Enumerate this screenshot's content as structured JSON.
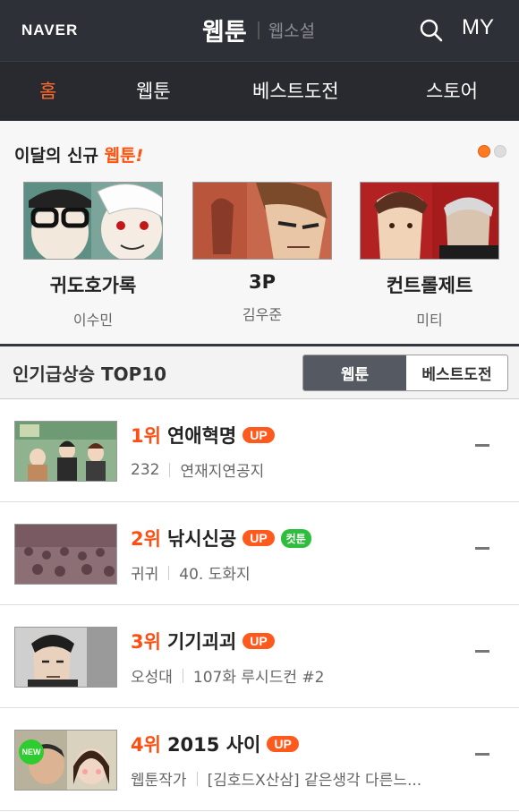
{
  "header": {
    "logo": "NAVER",
    "title": "웹툰",
    "subtitle": "웹소설",
    "search_icon": "search-icon",
    "my_label": "MY"
  },
  "nav": {
    "items": [
      {
        "label": "홈",
        "active": true
      },
      {
        "label": "웹툰",
        "active": false
      },
      {
        "label": "베스트도전",
        "active": false
      },
      {
        "label": "스토어",
        "active": false
      }
    ]
  },
  "new_section": {
    "title_prefix": "이달의 신규 ",
    "title_accent": "웹툰",
    "title_suffix": "!",
    "page_indicator": {
      "total": 2,
      "current": 1
    },
    "cards": [
      {
        "title": "귀도호가록",
        "author": "이수민"
      },
      {
        "title": "3P",
        "author": "김우준"
      },
      {
        "title": "컨트롤제트",
        "author": "미티"
      }
    ]
  },
  "top10": {
    "title": "인기급상승 TOP10",
    "toggle": {
      "active": "웹툰",
      "inactive": "베스트도전"
    },
    "items": [
      {
        "rank": "1위",
        "title": "연애혁명",
        "badge": "UP",
        "extra_badge": "",
        "new": false,
        "meta1": "232",
        "meta2": "연재지연공지"
      },
      {
        "rank": "2위",
        "title": "낚시신공",
        "badge": "UP",
        "extra_badge": "컷툰",
        "new": false,
        "meta1": "귀귀",
        "meta2": "40. 도화지"
      },
      {
        "rank": "3위",
        "title": "기기괴괴",
        "badge": "UP",
        "extra_badge": "",
        "new": false,
        "meta1": "오성대",
        "meta2": "107화 루시드컨 #2"
      },
      {
        "rank": "4위",
        "title": "2015 사이",
        "badge": "UP",
        "extra_badge": "",
        "new": true,
        "new_label": "NEW",
        "meta1": "웹툰작가",
        "meta2": "[김호드X산삼] 같은생각 다른느..."
      }
    ]
  },
  "colors": {
    "header_bg": "#2d3036",
    "nav_bg": "#282a2f",
    "accent": "#ff5a1e",
    "cut_badge": "#2fbd3d"
  }
}
